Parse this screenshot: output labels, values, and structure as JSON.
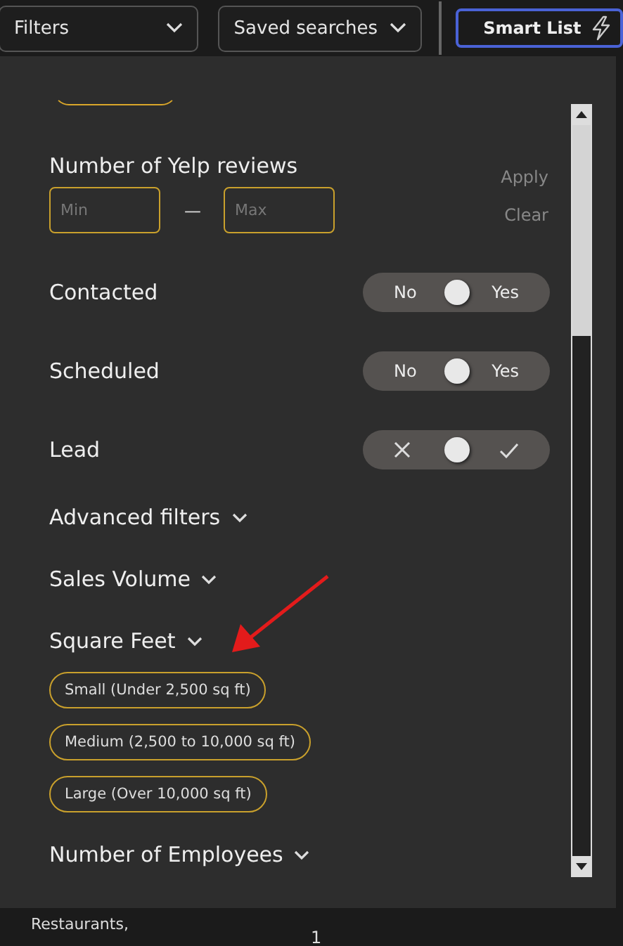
{
  "top_bar": {
    "filters_dropdown": "Filters",
    "saved_searches_dropdown": "Saved searches",
    "smart_list_button": "Smart List"
  },
  "yelp_reviews": {
    "label": "Number of Yelp reviews",
    "min": {
      "placeholder": "Min"
    },
    "separator": "—",
    "max": {
      "placeholder": "Max"
    },
    "apply": "Apply",
    "clear": "Clear"
  },
  "toggles": [
    {
      "label": "Contacted",
      "kind": "text",
      "off_label": "No",
      "on_label": "Yes",
      "level": 0.5
    },
    {
      "label": "Scheduled",
      "kind": "text",
      "off_label": "No",
      "on_label": "Yes",
      "level": 0.5
    },
    {
      "label": "Lead",
      "kind": "icon",
      "level": 0.5
    }
  ],
  "sections": [
    {
      "label": "Advanced filters"
    },
    {
      "label": "Sales Volume"
    },
    {
      "label": "Square Feet",
      "options": [
        {
          "label": "Small (Under 2,500 sq ft)",
          "selected": false
        },
        {
          "label": "Medium (2,500 to 10,000 sq ft)",
          "selected": false
        },
        {
          "label": "Large (Over 10,000 sq ft)",
          "selected": false
        }
      ]
    },
    {
      "label": "Number of Employees"
    }
  ],
  "background_row": {
    "column_1": "Restaurants,",
    "column_2": "1"
  }
}
